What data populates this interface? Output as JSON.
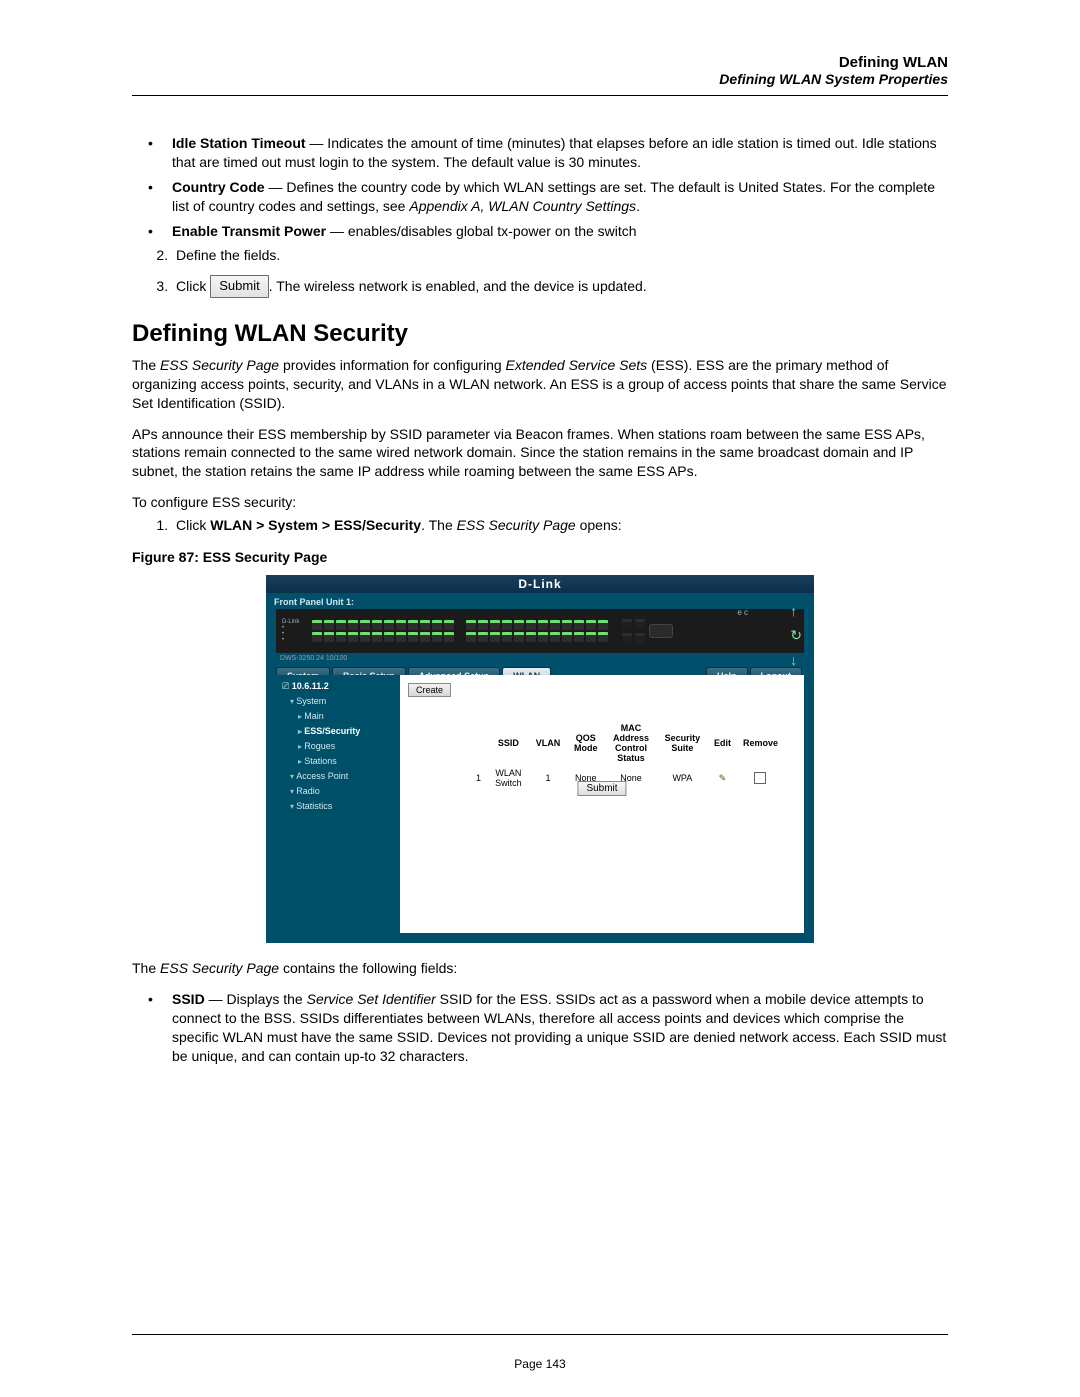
{
  "header": {
    "chapter": "Defining WLAN",
    "section": "Defining WLAN System Properties"
  },
  "bullets_top": [
    {
      "term": "Idle Station Timeout",
      "desc": " — Indicates the amount of time (minutes) that elapses before an idle station is timed out. Idle stations that are timed out must login to the system. The default value is 30 minutes."
    },
    {
      "term": "Country Code",
      "desc_pre": " — Defines the country code by which WLAN settings are set. The default is United States. For the complete list of country codes and settings, see ",
      "desc_ital": "Appendix A, WLAN Country Settings",
      "desc_post": "."
    },
    {
      "term": "Enable Transmit Power",
      "desc": " — enables/disables global tx-power on the switch"
    }
  ],
  "step2": "Define the fields.",
  "step3_pre": "Click ",
  "step3_chip": "Submit",
  "step3_post": ". The wireless network is enabled, and the device is updated.",
  "h2": "Defining WLAN Security",
  "para1_pre": "The ",
  "para1_ital1": "ESS Security Page",
  "para1_mid": " provides information for configuring ",
  "para1_ital2": "Extended Service Sets",
  "para1_post": " (ESS). ESS are the primary method of organizing access points, security, and VLANs in a WLAN network. An ESS is a group of access points that share the same Service Set Identification (SSID).",
  "para2": "APs announce their ESS membership by SSID parameter via Beacon frames. When stations roam between the same ESS APs, stations remain connected to the same wired network domain. Since the station remains in the same broadcast domain and IP subnet, the station retains the same IP address while roaming between the same ESS APs.",
  "para3": "To configure ESS security:",
  "step_nav_pre": "Click ",
  "step_nav_bold": "WLAN > System > ESS/Security",
  "step_nav_mid": ".  The ",
  "step_nav_ital": "ESS Security Page",
  "step_nav_post": " opens:",
  "figure_caption": "Figure 87:  ESS Security Page",
  "ui": {
    "brand": "D-Link",
    "front_panel_label": "Front Panel Unit 1:",
    "tabs": [
      "System",
      "Basic Setup",
      "Advanced Setup",
      "WLAN"
    ],
    "tab_active": "WLAN",
    "tabs_right": [
      "Help",
      "Logout"
    ],
    "sidebar_ip": "10.6.11.2",
    "sidebar": [
      "System",
      "Main",
      "ESS/Security",
      "Rogues",
      "Stations",
      "Access Point",
      "Radio",
      "Statistics"
    ],
    "create_label": "Create",
    "table_headers": [
      "",
      "SSID",
      "VLAN",
      "QOS Mode",
      "MAC Address Control Status",
      "Security Suite",
      "Edit",
      "Remove"
    ],
    "row": {
      "idx": "1",
      "ssid": "WLAN Switch",
      "vlan": "1",
      "qos": "None",
      "mac": "None",
      "sec": "WPA"
    },
    "submit_label": "Submit",
    "tiny_labels": "e     c"
  },
  "after_fig_pre": "The ",
  "after_fig_ital": "ESS Security Page",
  "after_fig_post": " contains the following fields:",
  "ssid_term": "SSID",
  "ssid_desc_pre": " — Displays the ",
  "ssid_desc_ital": "Service Set Identifier",
  "ssid_desc_post": " SSID for the ESS. SSIDs act as a password when a mobile device attempts to connect to the BSS. SSIDs differentiates between WLANs, therefore all access points and devices which comprise the specific WLAN must have the same SSID. Devices not providing a unique SSID are denied network access. Each SSID must be unique, and can contain up-to 32 characters.",
  "page_number": "Page 143"
}
